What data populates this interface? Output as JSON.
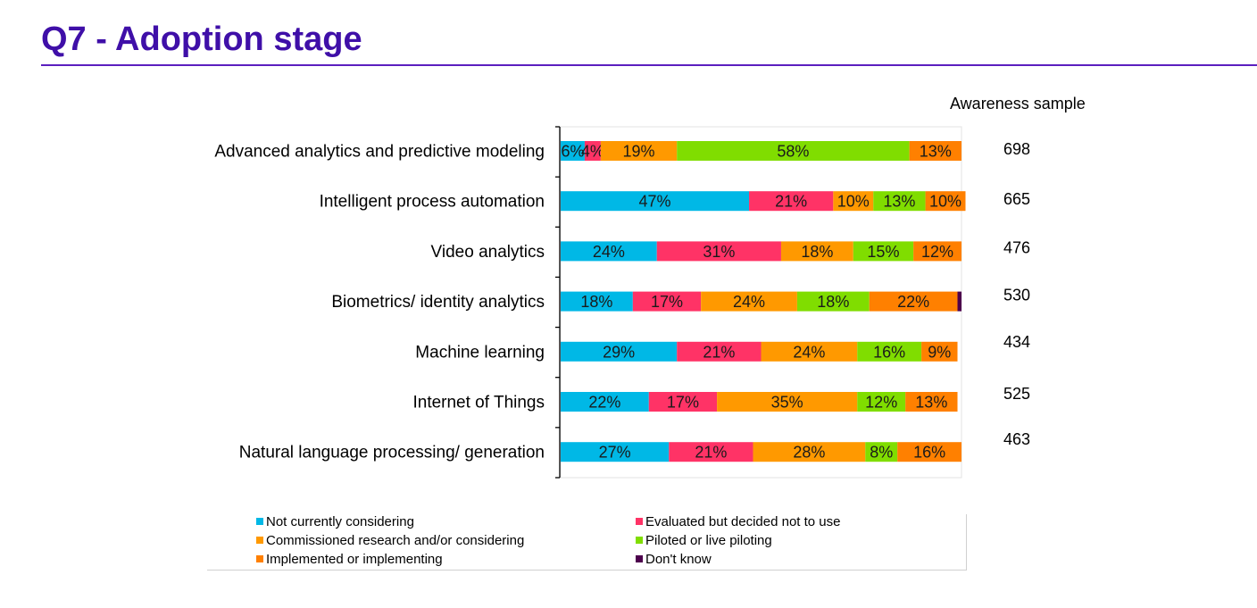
{
  "page": {
    "title": "Q7 - Adoption stage"
  },
  "sample_header": "Awareness sample",
  "chart_data": {
    "type": "bar",
    "orientation": "horizontal",
    "stacked": true,
    "title": "",
    "xlabel": "",
    "ylabel": "",
    "xlim": [
      0,
      100
    ],
    "value_unit": "%",
    "grid": false,
    "legend_position": "bottom",
    "categories": [
      "Advanced analytics and predictive modeling",
      "Intelligent process automation",
      "Video analytics",
      "Biometrics/ identity analytics",
      "Machine learning",
      "Internet of Things",
      "Natural language processing/ generation"
    ],
    "series": [
      {
        "name": "Not currently considering",
        "color": "#00b8e6",
        "values": [
          6,
          47,
          24,
          18,
          29,
          22,
          27
        ]
      },
      {
        "name": "Evaluated but decided not to use",
        "color": "#ff3366",
        "values": [
          4,
          21,
          31,
          17,
          21,
          17,
          21
        ]
      },
      {
        "name": "Commissioned research and/or considering",
        "color": "#ff9900",
        "values": [
          19,
          10,
          18,
          24,
          24,
          35,
          28
        ]
      },
      {
        "name": "Piloted or live piloting",
        "color": "#80dd00",
        "values": [
          58,
          13,
          15,
          18,
          16,
          12,
          8
        ]
      },
      {
        "name": "Implemented or implementing",
        "color": "#ff8000",
        "values": [
          13,
          10,
          12,
          22,
          9,
          13,
          16
        ]
      },
      {
        "name": "Don't know",
        "color": "#4d004d",
        "values": [
          0,
          0,
          0,
          1,
          0,
          0,
          0
        ]
      }
    ],
    "sample_sizes": [
      698,
      665,
      476,
      530,
      434,
      525,
      463
    ]
  }
}
